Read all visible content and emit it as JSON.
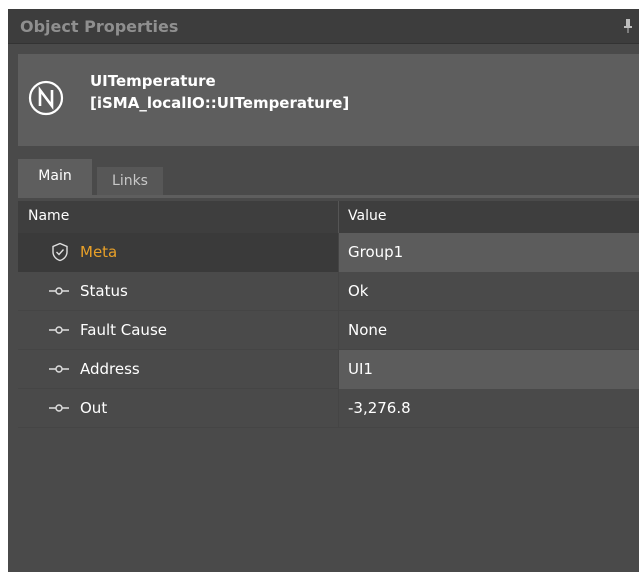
{
  "window": {
    "title": "Object Properties"
  },
  "object": {
    "name": "UITemperature",
    "type": "[iSMA_localIO::UITemperature]"
  },
  "tabs": [
    {
      "label": "Main",
      "active": true
    },
    {
      "label": "Links",
      "active": false
    }
  ],
  "grid": {
    "columns": {
      "name": "Name",
      "value": "Value"
    },
    "rows": [
      {
        "name": "Meta",
        "value": "Group1",
        "icon": "shield-icon"
      },
      {
        "name": "Status",
        "value": "Ok",
        "icon": "slot-icon"
      },
      {
        "name": "Fault Cause",
        "value": "None",
        "icon": "slot-icon"
      },
      {
        "name": "Address",
        "value": "UI1",
        "icon": "slot-icon"
      },
      {
        "name": "Out",
        "value": "-3,276.8",
        "icon": "slot-icon"
      }
    ]
  },
  "colors": {
    "panel_bg": "#4a4a4a",
    "header_bg": "#5e5e5e",
    "meta_accent": "#e8a028"
  }
}
